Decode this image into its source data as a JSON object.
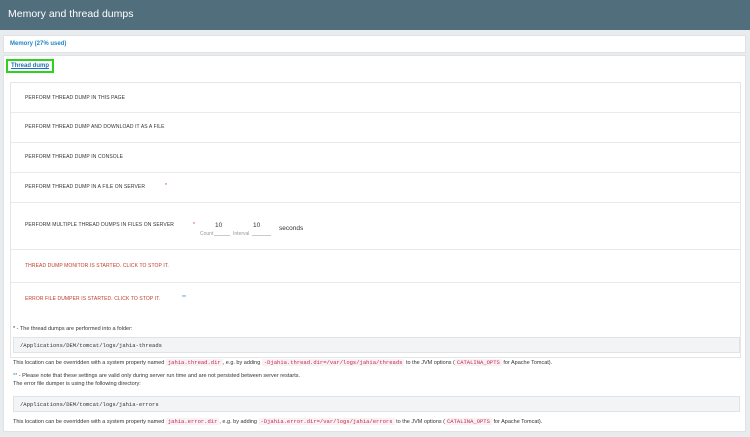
{
  "header": {
    "title": "Memory and thread dumps"
  },
  "memory": {
    "label": "Memory (27% used)"
  },
  "thread_dump": {
    "link": "Thread dump"
  },
  "actions": {
    "a1": "PERFORM THREAD DUMP IN THIS PAGE",
    "a2": "PERFORM THREAD DUMP AND DOWNLOAD IT AS A FILE",
    "a3": "PERFORM THREAD DUMP IN CONSOLE",
    "a4": "PERFORM THREAD DUMP IN A FILE ON SERVER",
    "a4_marker": "*",
    "a5": "PERFORM MULTIPLE THREAD DUMPS IN FILES ON SERVER",
    "a5_marker": "*",
    "count_label": "Count",
    "count_value": "10",
    "interval_label": "Interval",
    "interval_value": "10",
    "seconds": "seconds",
    "a6": "THREAD DUMP MONITOR IS STARTED. CLICK TO STOP IT.",
    "a7": "ERROR FILE DUMPER IS STARTED. CLICK TO STOP IT.",
    "a7_marker": "**"
  },
  "notes": {
    "folder_marker": "*",
    "folder_text": " - The thread dumps are performed into a folder:",
    "folder_path": "/Applications/DEM/tomcat/logs/jahia-threads",
    "override1_a": "This location can be overridden with a system property named ",
    "override1_prop": "jahia.thread.dir",
    "override1_b": ", e.g. by adding ",
    "override1_opt": "-Djahia.thread.dir=/var/logs/jahia/threads",
    "override1_c": " to the JVM options (",
    "override1_env": "CATALINA_OPTS",
    "override1_d": " for Apache Tomcat).",
    "runtime_marker": "**",
    "runtime_text": " - Please note that these settings are valid only during server run time and are not persisted between server restarts.",
    "error_dir_text": "The error file dumper is using the following directory:",
    "error_path": "/Applications/DEM/tomcat/logs/jahia-errors",
    "override2_a": "This location can be overridden with a system property named ",
    "override2_prop": "jahia.error.dir",
    "override2_b": ", e.g. by adding ",
    "override2_opt": "-Djahia.error.dir=/var/logs/jahia/errors",
    "override2_c": " to the JVM options (",
    "override2_env": "CATALINA_OPTS",
    "override2_d": " for Apache Tomcat)."
  }
}
